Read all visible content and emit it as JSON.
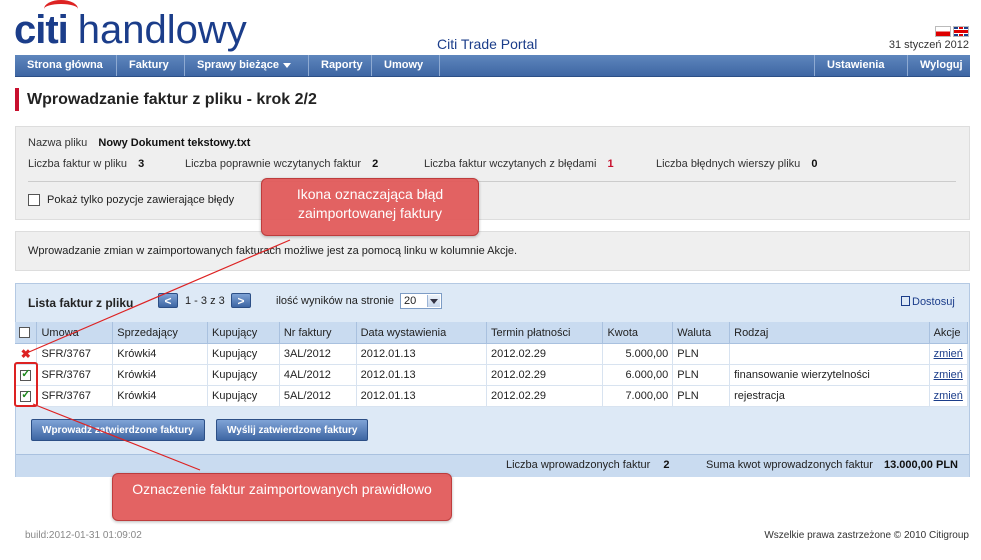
{
  "header": {
    "logo_citi": "citi",
    "logo_handlowy": "handlowy",
    "portal_name": "Citi Trade Portal",
    "date": "31 styczeń 2012"
  },
  "nav": {
    "items": [
      {
        "label": "Strona główna",
        "dropdown": false
      },
      {
        "label": "Faktury",
        "dropdown": true
      },
      {
        "label": "Sprawy bieżące",
        "dropdown": true
      },
      {
        "label": "Raporty",
        "dropdown": false
      },
      {
        "label": "Umowy",
        "dropdown": true
      }
    ],
    "right_items": [
      {
        "label": "Ustawienia",
        "dropdown": true
      },
      {
        "label": "Wyloguj",
        "dropdown": false
      }
    ]
  },
  "page_title": "Wprowadzanie faktur z pliku - krok 2/2",
  "file_info": {
    "file_name_label": "Nazwa pliku",
    "file_name": "Nowy Dokument tekstowy.txt",
    "invoice_count_label": "Liczba faktur w pliku",
    "invoice_count": "3",
    "correct_count_label": "Liczba poprawnie wczytanych faktur",
    "correct_count": "2",
    "error_count_label": "Liczba faktur wczytanych z błędami",
    "error_count": "1",
    "bad_rows_label": "Liczba błędnych wierszy pliku",
    "bad_rows": "0",
    "only_errors_label": "Pokaż tylko pozycje zawierające błędy"
  },
  "info_text": "Wprowadzanie zmian w zaimportowanych fakturach możliwe jest za pomocą linku w kolumnie Akcje.",
  "list": {
    "title": "Lista faktur z pliku",
    "prev": "<",
    "next": ">",
    "pagination": "1 - 3 z 3",
    "per_page_label": "ilość wyników na stronie",
    "per_page": "20",
    "customize": "Dostosuj",
    "columns": [
      "Umowa",
      "Sprzedający",
      "Kupujący",
      "Nr faktury",
      "Data wystawienia",
      "Termin płatności",
      "Kwota",
      "Waluta",
      "Rodzaj",
      "Akcje"
    ],
    "rows": [
      {
        "status": "error",
        "umowa": "SFR/3767",
        "sprzedajacy": "Krówki4",
        "kupujacy": "Kupujący",
        "nr": "3AL/2012",
        "data": "2012.01.13",
        "termin": "2012.02.29",
        "kwota": "5.000,00",
        "waluta": "PLN",
        "rodzaj": "",
        "akcja": "zmień"
      },
      {
        "status": "ok",
        "umowa": "SFR/3767",
        "sprzedajacy": "Krówki4",
        "kupujacy": "Kupujący",
        "nr": "4AL/2012",
        "data": "2012.01.13",
        "termin": "2012.02.29",
        "kwota": "6.000,00",
        "waluta": "PLN",
        "rodzaj": "finansowanie wierzytelności",
        "akcja": "zmień"
      },
      {
        "status": "ok",
        "umowa": "SFR/3767",
        "sprzedajacy": "Krówki4",
        "kupujacy": "Kupujący",
        "nr": "5AL/2012",
        "data": "2012.01.13",
        "termin": "2012.02.29",
        "kwota": "7.000,00",
        "waluta": "PLN",
        "rodzaj": "rejestracja",
        "akcja": "zmień"
      }
    ],
    "btn_enter": "Wprowadź zatwierdzone faktury",
    "btn_send": "Wyślij zatwierdzone faktury",
    "summary_count_label": "Liczba wprowadzonych faktur",
    "summary_count": "2",
    "summary_sum_label": "Suma kwot wprowadzonych faktur",
    "summary_sum": "13.000,00 PLN"
  },
  "callouts": {
    "error_icon": "Ikona oznaczająca błąd zaimportowanej faktury",
    "ok_invoices": "Oznaczenie faktur zaimportowanych prawidłowo"
  },
  "footer": {
    "build": "build:2012-01-31 01:09:02",
    "copyright": "Wszelkie prawa zastrzeżone © 2010 Citigroup"
  },
  "colors": {
    "brand_blue": "#1b3d8a",
    "nav_blue": "#3e66a3",
    "accent_red": "#c8102e",
    "callout_red": "#e25b5b"
  }
}
